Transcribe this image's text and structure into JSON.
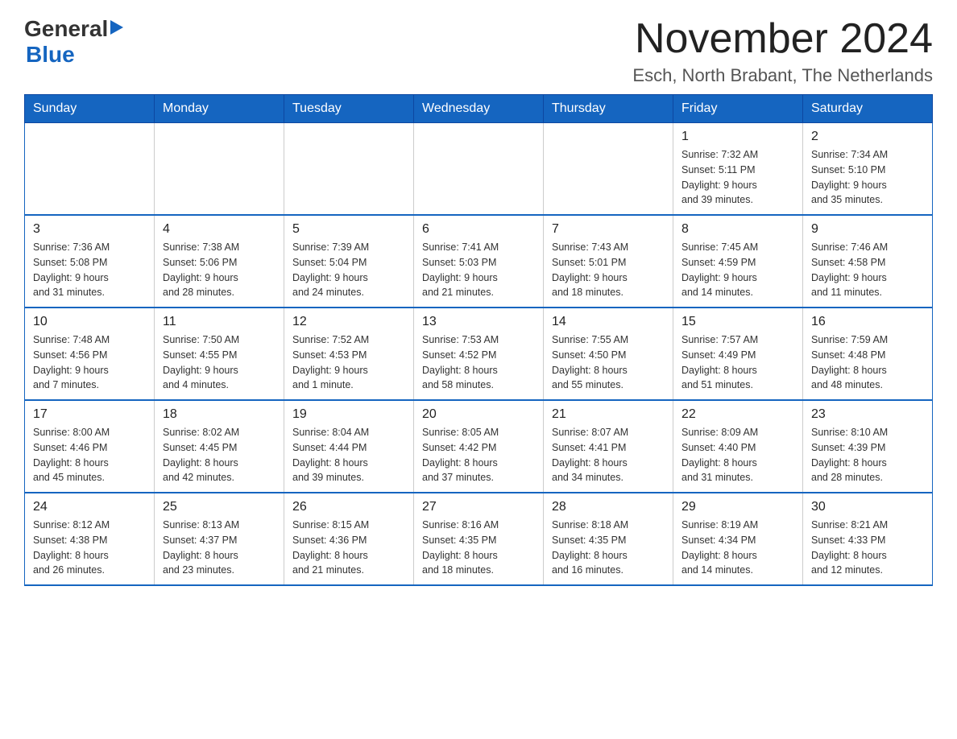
{
  "header": {
    "logo_general": "General",
    "logo_blue": "Blue",
    "title": "November 2024",
    "subtitle": "Esch, North Brabant, The Netherlands"
  },
  "days_header": [
    "Sunday",
    "Monday",
    "Tuesday",
    "Wednesday",
    "Thursday",
    "Friday",
    "Saturday"
  ],
  "weeks": [
    {
      "days": [
        {
          "num": "",
          "info": ""
        },
        {
          "num": "",
          "info": ""
        },
        {
          "num": "",
          "info": ""
        },
        {
          "num": "",
          "info": ""
        },
        {
          "num": "",
          "info": ""
        },
        {
          "num": "1",
          "info": "Sunrise: 7:32 AM\nSunset: 5:11 PM\nDaylight: 9 hours\nand 39 minutes."
        },
        {
          "num": "2",
          "info": "Sunrise: 7:34 AM\nSunset: 5:10 PM\nDaylight: 9 hours\nand 35 minutes."
        }
      ]
    },
    {
      "days": [
        {
          "num": "3",
          "info": "Sunrise: 7:36 AM\nSunset: 5:08 PM\nDaylight: 9 hours\nand 31 minutes."
        },
        {
          "num": "4",
          "info": "Sunrise: 7:38 AM\nSunset: 5:06 PM\nDaylight: 9 hours\nand 28 minutes."
        },
        {
          "num": "5",
          "info": "Sunrise: 7:39 AM\nSunset: 5:04 PM\nDaylight: 9 hours\nand 24 minutes."
        },
        {
          "num": "6",
          "info": "Sunrise: 7:41 AM\nSunset: 5:03 PM\nDaylight: 9 hours\nand 21 minutes."
        },
        {
          "num": "7",
          "info": "Sunrise: 7:43 AM\nSunset: 5:01 PM\nDaylight: 9 hours\nand 18 minutes."
        },
        {
          "num": "8",
          "info": "Sunrise: 7:45 AM\nSunset: 4:59 PM\nDaylight: 9 hours\nand 14 minutes."
        },
        {
          "num": "9",
          "info": "Sunrise: 7:46 AM\nSunset: 4:58 PM\nDaylight: 9 hours\nand 11 minutes."
        }
      ]
    },
    {
      "days": [
        {
          "num": "10",
          "info": "Sunrise: 7:48 AM\nSunset: 4:56 PM\nDaylight: 9 hours\nand 7 minutes."
        },
        {
          "num": "11",
          "info": "Sunrise: 7:50 AM\nSunset: 4:55 PM\nDaylight: 9 hours\nand 4 minutes."
        },
        {
          "num": "12",
          "info": "Sunrise: 7:52 AM\nSunset: 4:53 PM\nDaylight: 9 hours\nand 1 minute."
        },
        {
          "num": "13",
          "info": "Sunrise: 7:53 AM\nSunset: 4:52 PM\nDaylight: 8 hours\nand 58 minutes."
        },
        {
          "num": "14",
          "info": "Sunrise: 7:55 AM\nSunset: 4:50 PM\nDaylight: 8 hours\nand 55 minutes."
        },
        {
          "num": "15",
          "info": "Sunrise: 7:57 AM\nSunset: 4:49 PM\nDaylight: 8 hours\nand 51 minutes."
        },
        {
          "num": "16",
          "info": "Sunrise: 7:59 AM\nSunset: 4:48 PM\nDaylight: 8 hours\nand 48 minutes."
        }
      ]
    },
    {
      "days": [
        {
          "num": "17",
          "info": "Sunrise: 8:00 AM\nSunset: 4:46 PM\nDaylight: 8 hours\nand 45 minutes."
        },
        {
          "num": "18",
          "info": "Sunrise: 8:02 AM\nSunset: 4:45 PM\nDaylight: 8 hours\nand 42 minutes."
        },
        {
          "num": "19",
          "info": "Sunrise: 8:04 AM\nSunset: 4:44 PM\nDaylight: 8 hours\nand 39 minutes."
        },
        {
          "num": "20",
          "info": "Sunrise: 8:05 AM\nSunset: 4:42 PM\nDaylight: 8 hours\nand 37 minutes."
        },
        {
          "num": "21",
          "info": "Sunrise: 8:07 AM\nSunset: 4:41 PM\nDaylight: 8 hours\nand 34 minutes."
        },
        {
          "num": "22",
          "info": "Sunrise: 8:09 AM\nSunset: 4:40 PM\nDaylight: 8 hours\nand 31 minutes."
        },
        {
          "num": "23",
          "info": "Sunrise: 8:10 AM\nSunset: 4:39 PM\nDaylight: 8 hours\nand 28 minutes."
        }
      ]
    },
    {
      "days": [
        {
          "num": "24",
          "info": "Sunrise: 8:12 AM\nSunset: 4:38 PM\nDaylight: 8 hours\nand 26 minutes."
        },
        {
          "num": "25",
          "info": "Sunrise: 8:13 AM\nSunset: 4:37 PM\nDaylight: 8 hours\nand 23 minutes."
        },
        {
          "num": "26",
          "info": "Sunrise: 8:15 AM\nSunset: 4:36 PM\nDaylight: 8 hours\nand 21 minutes."
        },
        {
          "num": "27",
          "info": "Sunrise: 8:16 AM\nSunset: 4:35 PM\nDaylight: 8 hours\nand 18 minutes."
        },
        {
          "num": "28",
          "info": "Sunrise: 8:18 AM\nSunset: 4:35 PM\nDaylight: 8 hours\nand 16 minutes."
        },
        {
          "num": "29",
          "info": "Sunrise: 8:19 AM\nSunset: 4:34 PM\nDaylight: 8 hours\nand 14 minutes."
        },
        {
          "num": "30",
          "info": "Sunrise: 8:21 AM\nSunset: 4:33 PM\nDaylight: 8 hours\nand 12 minutes."
        }
      ]
    }
  ]
}
